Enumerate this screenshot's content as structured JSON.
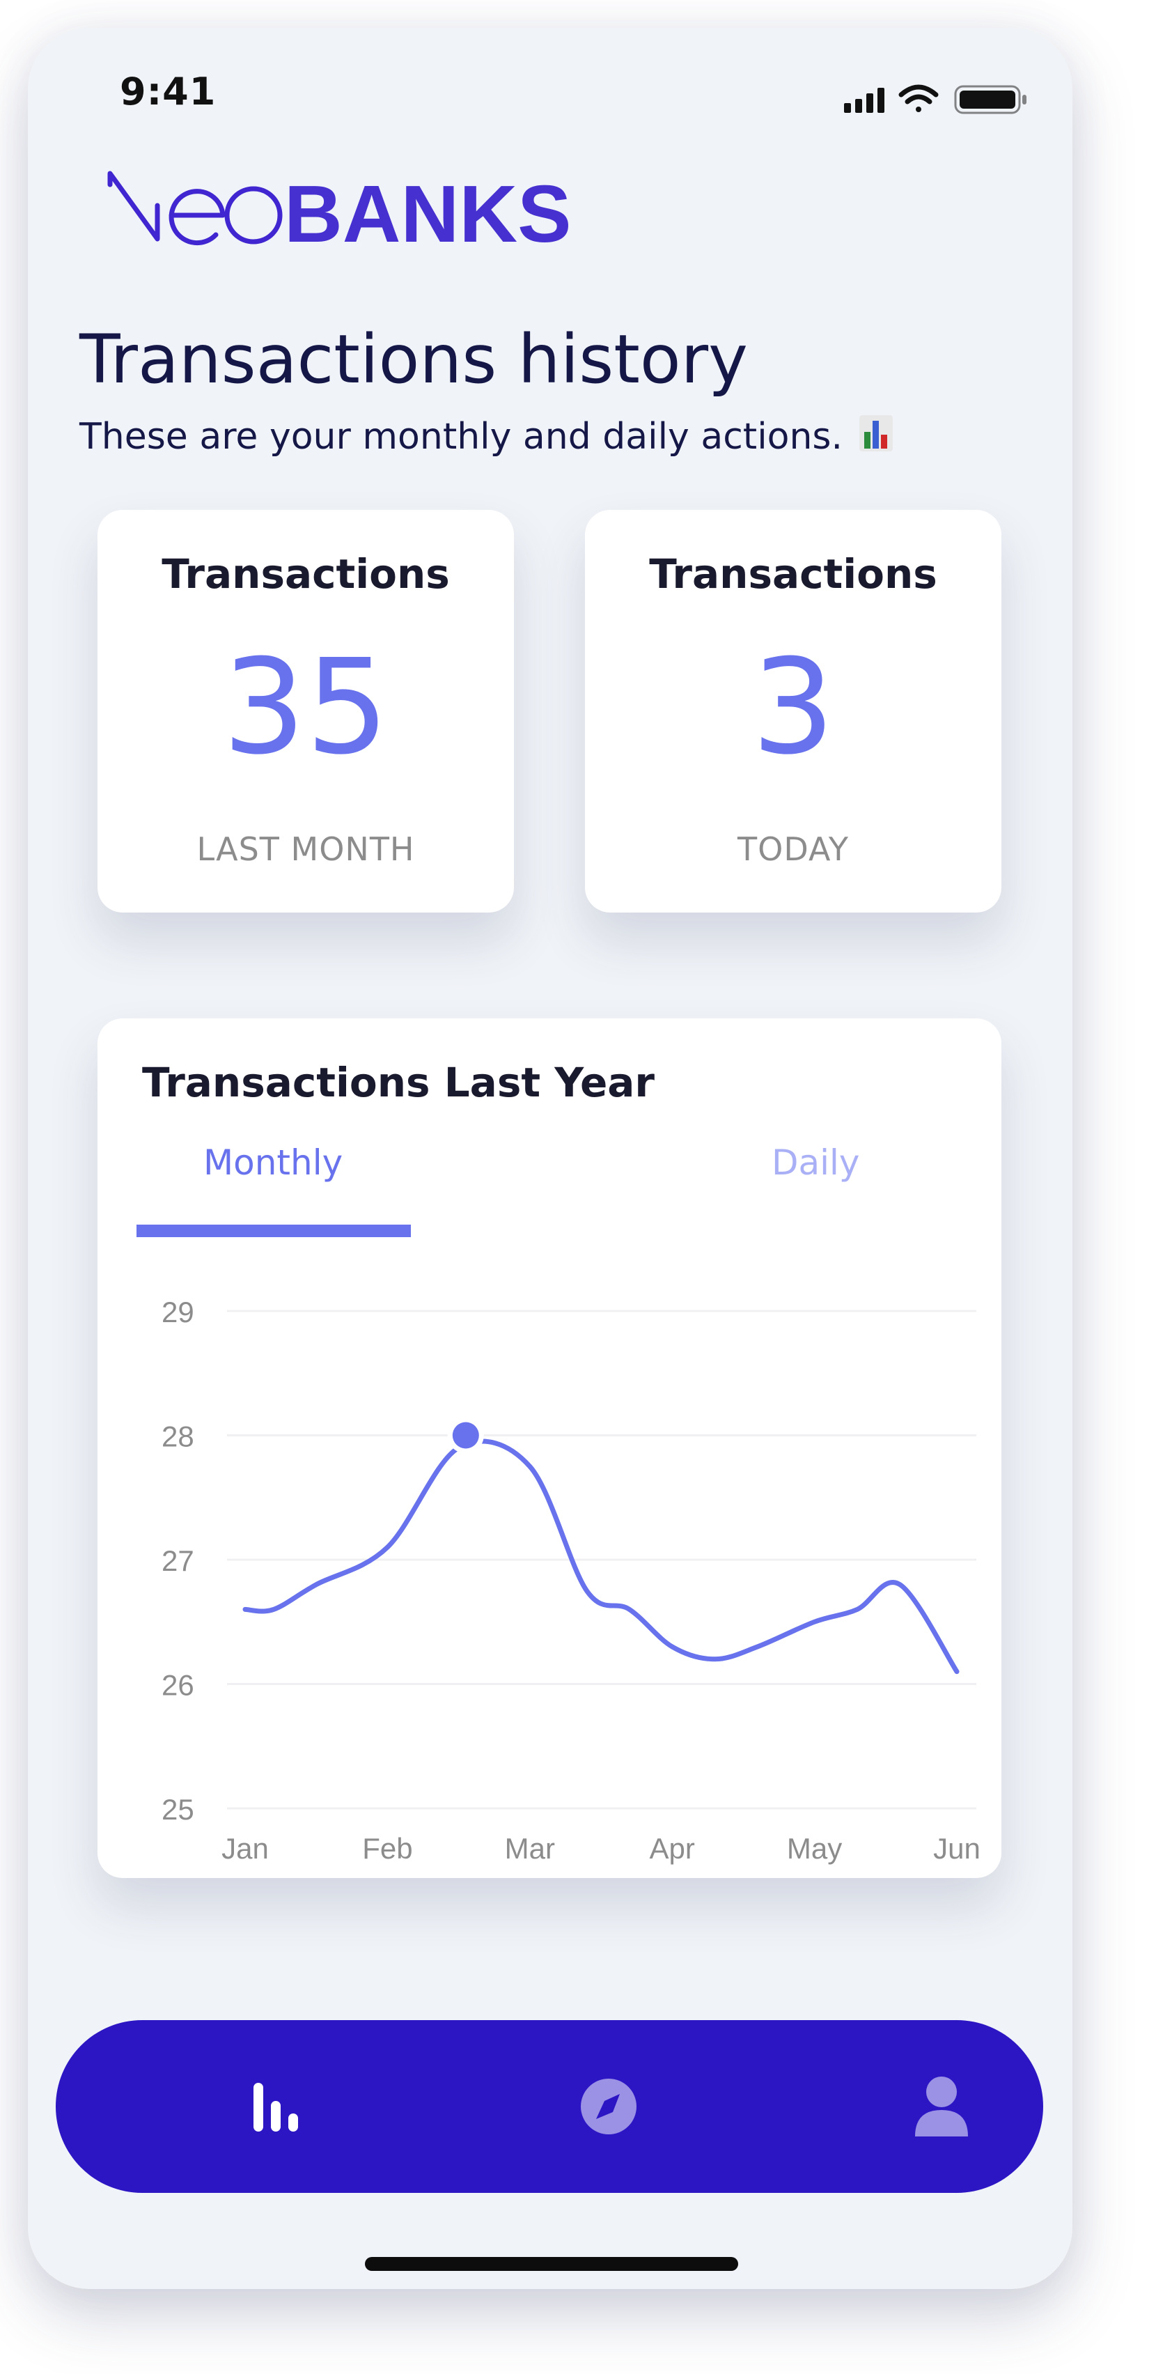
{
  "status_bar": {
    "time": "9:41"
  },
  "brand": {
    "name_prefix": "neo",
    "name_suffix": "BANKS"
  },
  "header": {
    "title": "Transactions history",
    "subtitle": "These are your monthly and daily actions."
  },
  "stats": [
    {
      "title": "Transactions",
      "value": "35",
      "label": "LAST MONTH"
    },
    {
      "title": "Transactions",
      "value": "3",
      "label": "TODAY"
    }
  ],
  "chart_card": {
    "title": "Transactions Last Year",
    "tabs": [
      {
        "label": "Monthly",
        "active": true
      },
      {
        "label": "Daily",
        "active": false
      }
    ]
  },
  "chart_data": {
    "type": "line",
    "title": "Transactions Last Year",
    "x": [
      "Jan",
      "Feb",
      "Mar",
      "Apr",
      "May",
      "Jun"
    ],
    "xlabel": "",
    "ylabel": "",
    "ylim": [
      25,
      29
    ],
    "yticks": [
      25,
      26,
      27,
      28,
      29
    ],
    "grid": true,
    "series": [
      {
        "x": [
          0.0,
          0.2,
          0.5,
          1.0,
          1.5,
          2.0,
          2.4,
          2.7,
          3.0,
          3.3,
          3.6,
          4.0,
          4.3,
          4.6,
          5.0
        ],
        "y": [
          26.6,
          26.6,
          26.8,
          27.1,
          27.9,
          27.75,
          26.75,
          26.6,
          26.3,
          26.2,
          26.3,
          26.5,
          26.6,
          26.8,
          26.1
        ]
      }
    ],
    "highlight": {
      "x": 1.55,
      "y": 28.0
    },
    "colors": {
      "line": "#6772ec",
      "grid": "#f0f0f3",
      "tick": "#8c8c8c"
    }
  },
  "nav": {
    "items": [
      {
        "icon": "bar-chart-icon",
        "active": true
      },
      {
        "icon": "compass-icon",
        "active": false
      },
      {
        "icon": "user-icon",
        "active": false
      }
    ]
  },
  "colors": {
    "brand_primary": "#2c16c4",
    "accent": "#6772ec",
    "background": "#f0f3f7",
    "text_dark": "#151847"
  }
}
